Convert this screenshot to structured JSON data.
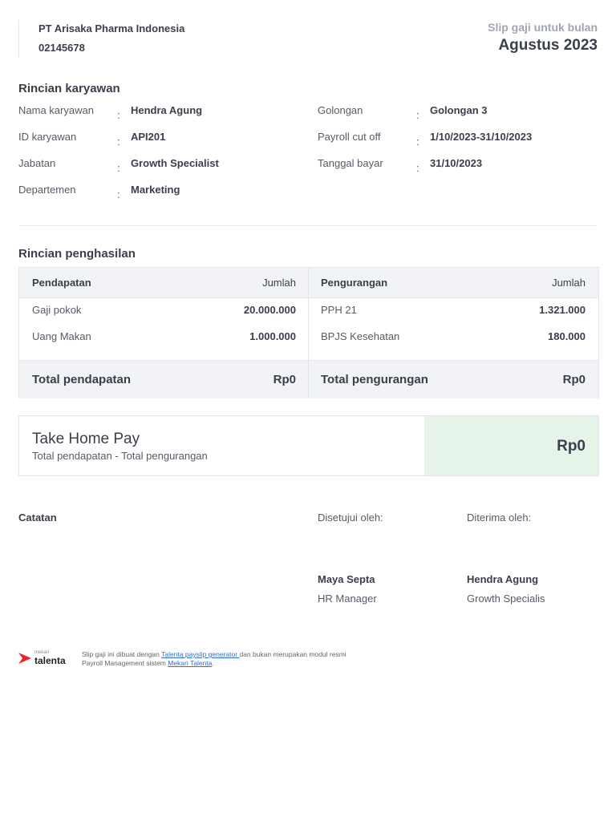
{
  "company": {
    "name": "PT Arisaka Pharma Indonesia",
    "number": "02145678"
  },
  "slip": {
    "label": "Slip gaji untuk bulan",
    "period": "Agustus 2023"
  },
  "employee": {
    "title": "Rincian karyawan",
    "fields": [
      {
        "label": "Nama karyawan",
        "value": "Hendra Agung"
      },
      {
        "label": "ID karyawan",
        "value": "API201"
      },
      {
        "label": "Jabatan",
        "value": "Growth Specialist"
      },
      {
        "label": "Departemen",
        "value": "Marketing"
      },
      {
        "label": "Golongan",
        "value": "Golongan 3"
      },
      {
        "label": "Payroll cut off",
        "value": "1/10/2023-31/10/2023"
      },
      {
        "label": "Tanggal bayar",
        "value": "31/10/2023"
      }
    ],
    "colon": ":"
  },
  "income": {
    "title": "Rincian penghasilan",
    "earnings": {
      "header": "Pendapatan",
      "amount_header": "Jumlah",
      "rows": [
        {
          "name": "Gaji pokok",
          "amount": "20.000.000"
        },
        {
          "name": "Uang Makan",
          "amount": "1.000.000"
        }
      ],
      "total_label": "Total pendapatan",
      "total": "Rp0"
    },
    "deductions": {
      "header": "Pengurangan",
      "amount_header": "Jumlah",
      "rows": [
        {
          "name": "PPH 21",
          "amount": "1.321.000"
        },
        {
          "name": "BPJS Kesehatan",
          "amount": "180.000"
        }
      ],
      "total_label": "Total pengurangan",
      "total": "Rp0"
    }
  },
  "thp": {
    "title": "Take Home Pay",
    "subtitle": "Total pendapatan - Total pengurangan",
    "amount": "Rp0"
  },
  "notes": {
    "label": "Catatan"
  },
  "approved": {
    "label": "Disetujui oleh:",
    "name": "Maya Septa",
    "role": "HR Manager"
  },
  "received": {
    "label": "Diterima oleh:",
    "name": "Hendra Agung",
    "role": "Growth Specialis"
  },
  "footer": {
    "logo_small": "mekari",
    "logo": "talenta",
    "text1": "Slip gaji ini dibuat dengan ",
    "link1": "Talenta payslip generator ",
    "text2": "dan bukan merupakan modul resmi Payroll Management sistem ",
    "link2": "Mekari Talenta",
    "text3": "."
  }
}
